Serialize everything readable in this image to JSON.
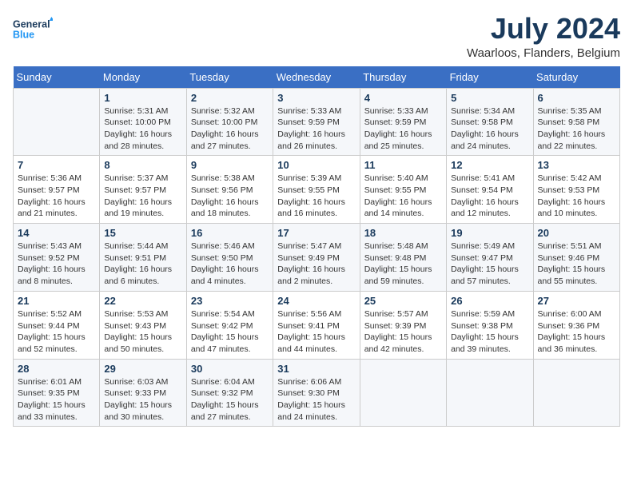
{
  "header": {
    "logo_line1": "General",
    "logo_line2": "Blue",
    "month_year": "July 2024",
    "location": "Waarloos, Flanders, Belgium"
  },
  "days_of_week": [
    "Sunday",
    "Monday",
    "Tuesday",
    "Wednesday",
    "Thursday",
    "Friday",
    "Saturday"
  ],
  "weeks": [
    [
      {
        "day": "",
        "detail": ""
      },
      {
        "day": "1",
        "detail": "Sunrise: 5:31 AM\nSunset: 10:00 PM\nDaylight: 16 hours\nand 28 minutes."
      },
      {
        "day": "2",
        "detail": "Sunrise: 5:32 AM\nSunset: 10:00 PM\nDaylight: 16 hours\nand 27 minutes."
      },
      {
        "day": "3",
        "detail": "Sunrise: 5:33 AM\nSunset: 9:59 PM\nDaylight: 16 hours\nand 26 minutes."
      },
      {
        "day": "4",
        "detail": "Sunrise: 5:33 AM\nSunset: 9:59 PM\nDaylight: 16 hours\nand 25 minutes."
      },
      {
        "day": "5",
        "detail": "Sunrise: 5:34 AM\nSunset: 9:58 PM\nDaylight: 16 hours\nand 24 minutes."
      },
      {
        "day": "6",
        "detail": "Sunrise: 5:35 AM\nSunset: 9:58 PM\nDaylight: 16 hours\nand 22 minutes."
      }
    ],
    [
      {
        "day": "7",
        "detail": "Sunrise: 5:36 AM\nSunset: 9:57 PM\nDaylight: 16 hours\nand 21 minutes."
      },
      {
        "day": "8",
        "detail": "Sunrise: 5:37 AM\nSunset: 9:57 PM\nDaylight: 16 hours\nand 19 minutes."
      },
      {
        "day": "9",
        "detail": "Sunrise: 5:38 AM\nSunset: 9:56 PM\nDaylight: 16 hours\nand 18 minutes."
      },
      {
        "day": "10",
        "detail": "Sunrise: 5:39 AM\nSunset: 9:55 PM\nDaylight: 16 hours\nand 16 minutes."
      },
      {
        "day": "11",
        "detail": "Sunrise: 5:40 AM\nSunset: 9:55 PM\nDaylight: 16 hours\nand 14 minutes."
      },
      {
        "day": "12",
        "detail": "Sunrise: 5:41 AM\nSunset: 9:54 PM\nDaylight: 16 hours\nand 12 minutes."
      },
      {
        "day": "13",
        "detail": "Sunrise: 5:42 AM\nSunset: 9:53 PM\nDaylight: 16 hours\nand 10 minutes."
      }
    ],
    [
      {
        "day": "14",
        "detail": "Sunrise: 5:43 AM\nSunset: 9:52 PM\nDaylight: 16 hours\nand 8 minutes."
      },
      {
        "day": "15",
        "detail": "Sunrise: 5:44 AM\nSunset: 9:51 PM\nDaylight: 16 hours\nand 6 minutes."
      },
      {
        "day": "16",
        "detail": "Sunrise: 5:46 AM\nSunset: 9:50 PM\nDaylight: 16 hours\nand 4 minutes."
      },
      {
        "day": "17",
        "detail": "Sunrise: 5:47 AM\nSunset: 9:49 PM\nDaylight: 16 hours\nand 2 minutes."
      },
      {
        "day": "18",
        "detail": "Sunrise: 5:48 AM\nSunset: 9:48 PM\nDaylight: 15 hours\nand 59 minutes."
      },
      {
        "day": "19",
        "detail": "Sunrise: 5:49 AM\nSunset: 9:47 PM\nDaylight: 15 hours\nand 57 minutes."
      },
      {
        "day": "20",
        "detail": "Sunrise: 5:51 AM\nSunset: 9:46 PM\nDaylight: 15 hours\nand 55 minutes."
      }
    ],
    [
      {
        "day": "21",
        "detail": "Sunrise: 5:52 AM\nSunset: 9:44 PM\nDaylight: 15 hours\nand 52 minutes."
      },
      {
        "day": "22",
        "detail": "Sunrise: 5:53 AM\nSunset: 9:43 PM\nDaylight: 15 hours\nand 50 minutes."
      },
      {
        "day": "23",
        "detail": "Sunrise: 5:54 AM\nSunset: 9:42 PM\nDaylight: 15 hours\nand 47 minutes."
      },
      {
        "day": "24",
        "detail": "Sunrise: 5:56 AM\nSunset: 9:41 PM\nDaylight: 15 hours\nand 44 minutes."
      },
      {
        "day": "25",
        "detail": "Sunrise: 5:57 AM\nSunset: 9:39 PM\nDaylight: 15 hours\nand 42 minutes."
      },
      {
        "day": "26",
        "detail": "Sunrise: 5:59 AM\nSunset: 9:38 PM\nDaylight: 15 hours\nand 39 minutes."
      },
      {
        "day": "27",
        "detail": "Sunrise: 6:00 AM\nSunset: 9:36 PM\nDaylight: 15 hours\nand 36 minutes."
      }
    ],
    [
      {
        "day": "28",
        "detail": "Sunrise: 6:01 AM\nSunset: 9:35 PM\nDaylight: 15 hours\nand 33 minutes."
      },
      {
        "day": "29",
        "detail": "Sunrise: 6:03 AM\nSunset: 9:33 PM\nDaylight: 15 hours\nand 30 minutes."
      },
      {
        "day": "30",
        "detail": "Sunrise: 6:04 AM\nSunset: 9:32 PM\nDaylight: 15 hours\nand 27 minutes."
      },
      {
        "day": "31",
        "detail": "Sunrise: 6:06 AM\nSunset: 9:30 PM\nDaylight: 15 hours\nand 24 minutes."
      },
      {
        "day": "",
        "detail": ""
      },
      {
        "day": "",
        "detail": ""
      },
      {
        "day": "",
        "detail": ""
      }
    ]
  ]
}
